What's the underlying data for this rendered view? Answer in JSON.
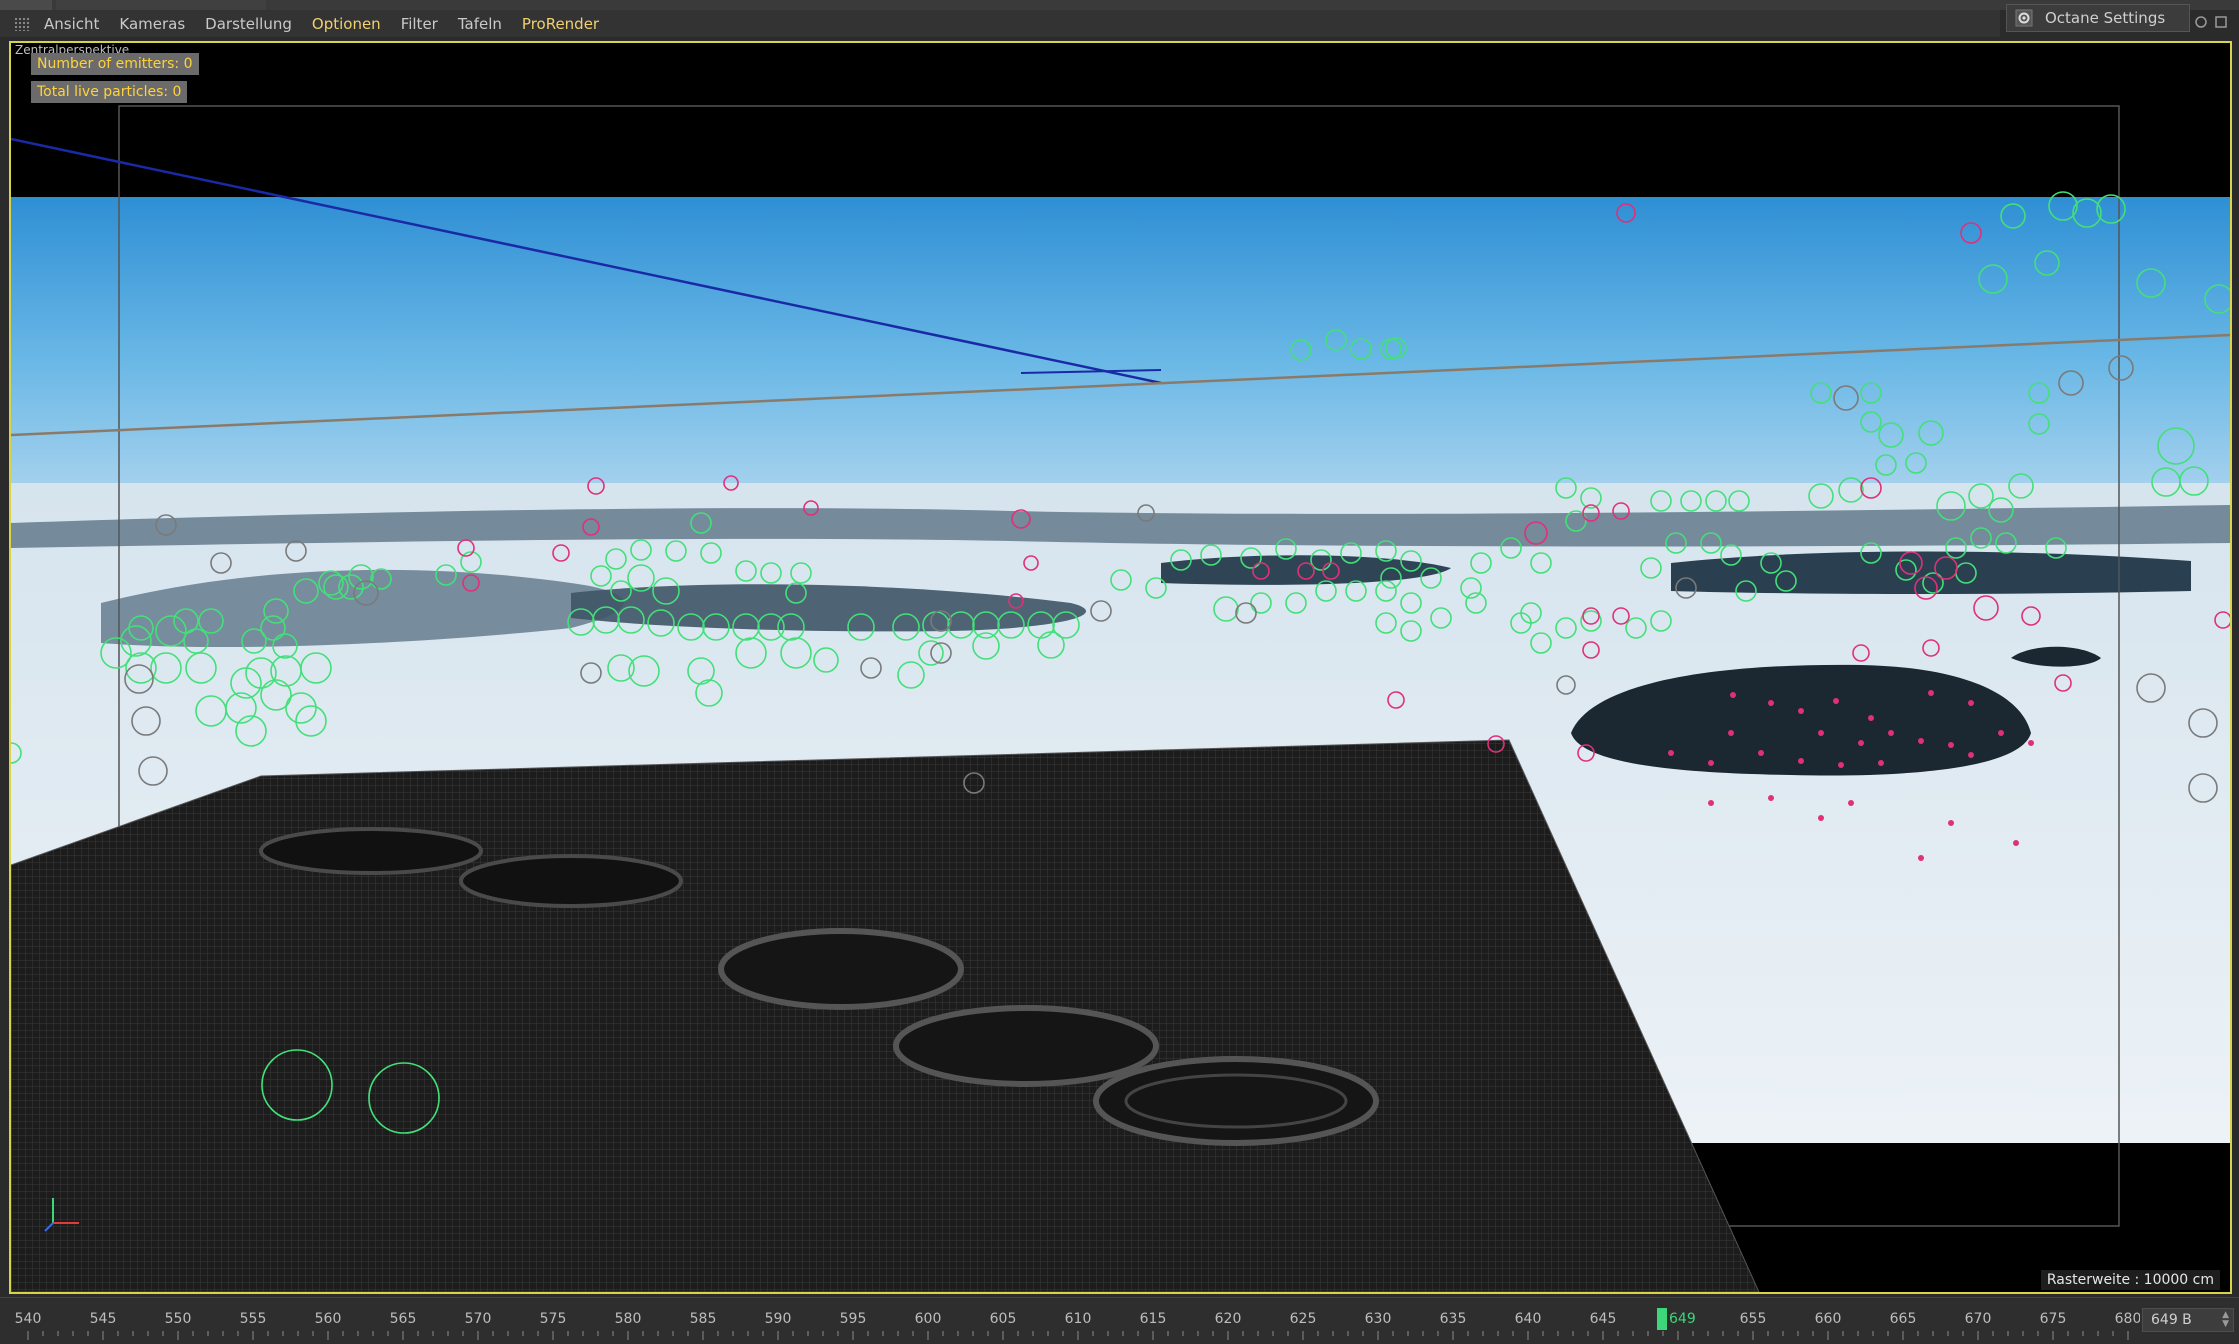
{
  "menu": {
    "items": [
      {
        "label": "Ansicht",
        "highlight": false
      },
      {
        "label": "Kameras",
        "highlight": false
      },
      {
        "label": "Darstellung",
        "highlight": false
      },
      {
        "label": "Optionen",
        "highlight": true
      },
      {
        "label": "Filter",
        "highlight": false
      },
      {
        "label": "Tafeln",
        "highlight": false
      },
      {
        "label": "ProRender",
        "highlight": true
      }
    ]
  },
  "octane": {
    "label": "Octane Settings",
    "icon": "gear-icon"
  },
  "viewport": {
    "name": "Zentralperspektive",
    "hud_emitters": "Number of emitters: 0",
    "hud_particles": "Total live particles: 0",
    "grid_size": "Rasterweite : 10000 cm"
  },
  "timeline": {
    "ticks": [
      540,
      545,
      550,
      555,
      560,
      565,
      570,
      575,
      580,
      585,
      590,
      595,
      600,
      605,
      610,
      615,
      620,
      625,
      630,
      635,
      640,
      645,
      649,
      655,
      660,
      665,
      670,
      675,
      680
    ],
    "tick_labels": [
      "540",
      "545",
      "550",
      "555",
      "560",
      "565",
      "570",
      "575",
      "580",
      "585",
      "590",
      "595",
      "600",
      "605",
      "610",
      "615",
      "620",
      "625",
      "630",
      "635",
      "640",
      "645",
      "649",
      "655",
      "660",
      "665",
      "670",
      "675",
      "680"
    ],
    "current_frame": 649,
    "frame_field": "649 B"
  },
  "colors": {
    "viewport_border": "#d8d44a",
    "hud_text": "#ffd23c",
    "menu_highlight": "#f0d070",
    "playhead": "#3ed67a",
    "green_particles": "#43e07a",
    "pink_particles": "#e0307a"
  }
}
